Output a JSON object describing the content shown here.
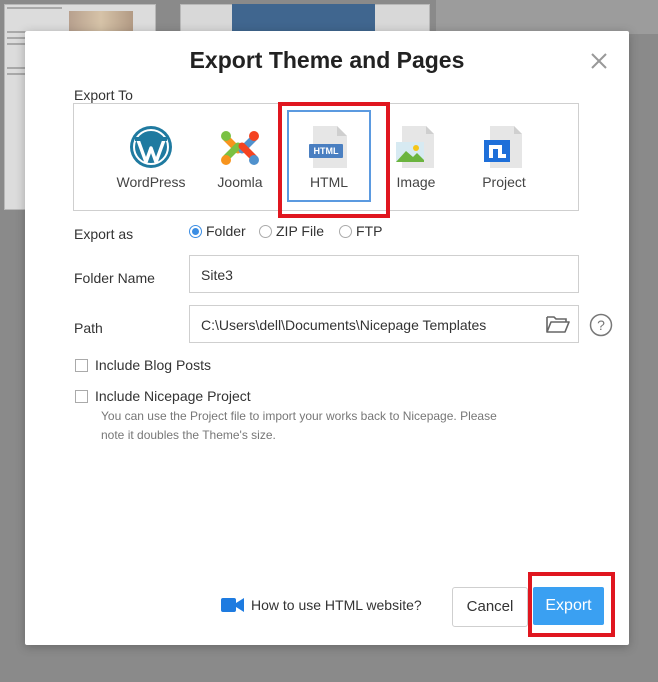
{
  "dialog": {
    "title": "Export Theme and Pages",
    "close_icon": "close-icon"
  },
  "export_to": {
    "label": "Export To",
    "targets": [
      {
        "label": "WordPress",
        "icon": "wordpress-icon",
        "selected": false
      },
      {
        "label": "Joomla",
        "icon": "joomla-icon",
        "selected": false
      },
      {
        "label": "HTML",
        "icon": "html-file-icon",
        "selected": true
      },
      {
        "label": "Image",
        "icon": "image-file-icon",
        "selected": false
      },
      {
        "label": "Project",
        "icon": "nicepage-project-icon",
        "selected": false
      }
    ],
    "html_badge": "HTML"
  },
  "export_as": {
    "label": "Export as",
    "options": [
      {
        "label": "Folder",
        "checked": true
      },
      {
        "label": "ZIP File",
        "checked": false
      },
      {
        "label": "FTP",
        "checked": false
      }
    ]
  },
  "folder_name": {
    "label": "Folder Name",
    "value": "Site3"
  },
  "path": {
    "label": "Path",
    "value": "C:\\Users\\dell\\Documents\\Nicepage Templates",
    "browse_icon": "folder-open-icon",
    "help_icon": "help-icon"
  },
  "options": {
    "include_blog_posts": {
      "label": "Include Blog Posts",
      "checked": false
    },
    "include_project": {
      "label": "Include Nicepage Project",
      "checked": false
    },
    "project_note": "You can use the Project file to import your works back to Nicepage. Please note it doubles the Theme's size."
  },
  "footer": {
    "howto_label": "How to use HTML website?",
    "howto_icon": "video-camera-icon",
    "cancel_label": "Cancel",
    "export_label": "Export"
  },
  "colors": {
    "accent": "#3aa0f2",
    "highlight": "#e0161f",
    "selected_border": "#5b9ae0"
  }
}
